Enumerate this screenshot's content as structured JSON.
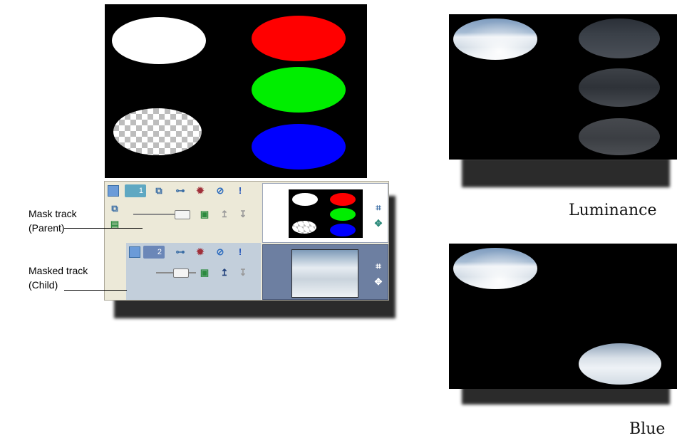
{
  "labels": {
    "mask_track": [
      "Mask track",
      "(Parent)"
    ],
    "masked_track": [
      "Masked track",
      "(Child)"
    ]
  },
  "captions": {
    "luminance": "Luminance",
    "blue": "Blue"
  },
  "tracks": [
    {
      "number": "1",
      "role": "parent"
    },
    {
      "number": "2",
      "role": "child"
    }
  ],
  "colors": {
    "red": "#ff0000",
    "green": "#00ee00",
    "blue": "#0000ff",
    "white": "#ffffff",
    "panel_bg": "#ece9d8",
    "child_header": "#c3cfdb",
    "child_media": "#6d7fa1"
  },
  "icons": [
    "compositing-mode-icon",
    "parent-compositing-icon",
    "track-motion-icon",
    "track-fx-icon",
    "mute-icon",
    "solo-icon",
    "crop-icon",
    "pan-icon",
    "mask-generator-icon",
    "make-parent-icon",
    "make-child-icon"
  ]
}
